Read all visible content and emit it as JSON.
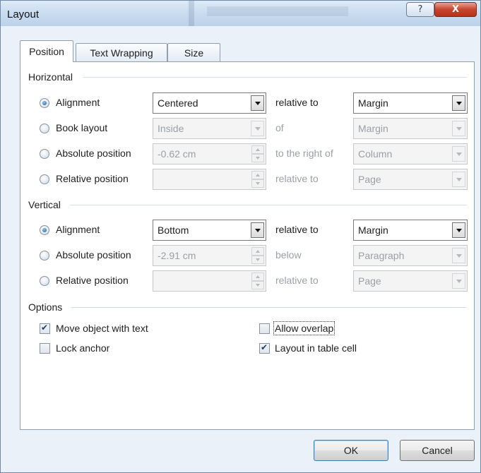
{
  "window": {
    "title": "Layout",
    "help_glyph": "?",
    "close_glyph": "X"
  },
  "tabs": [
    {
      "label": "Position",
      "active": true
    },
    {
      "label": "Text Wrapping",
      "active": false
    },
    {
      "label": "Size",
      "active": false
    }
  ],
  "horizontal": {
    "label": "Horizontal",
    "alignment": {
      "label": "Alignment",
      "selected": true,
      "value": "Centered",
      "mid": "relative to",
      "target": "Margin"
    },
    "book_layout": {
      "label": "Book layout",
      "selected": false,
      "value": "Inside",
      "mid": "of",
      "target": "Margin"
    },
    "absolute_position": {
      "label": "Absolute position",
      "selected": false,
      "value": "-0.62 cm",
      "mid": "to the right of",
      "target": "Column"
    },
    "relative_position": {
      "label": "Relative position",
      "selected": false,
      "value": "",
      "mid": "relative to",
      "target": "Page"
    }
  },
  "vertical": {
    "label": "Vertical",
    "alignment": {
      "label": "Alignment",
      "selected": true,
      "value": "Bottom",
      "mid": "relative to",
      "target": "Margin"
    },
    "absolute_position": {
      "label": "Absolute position",
      "selected": false,
      "value": "-2.91 cm",
      "mid": "below",
      "target": "Paragraph"
    },
    "relative_position": {
      "label": "Relative position",
      "selected": false,
      "value": "",
      "mid": "relative to",
      "target": "Page"
    }
  },
  "options": {
    "label": "Options",
    "move_object": {
      "label": "Move object with text",
      "checked": true
    },
    "lock_anchor": {
      "label": "Lock anchor",
      "checked": false
    },
    "allow_overlap": {
      "label": "Allow overlap",
      "checked": false
    },
    "layout_in_cell": {
      "label": "Layout in table cell",
      "checked": true
    }
  },
  "buttons": {
    "ok": "OK",
    "cancel": "Cancel"
  }
}
